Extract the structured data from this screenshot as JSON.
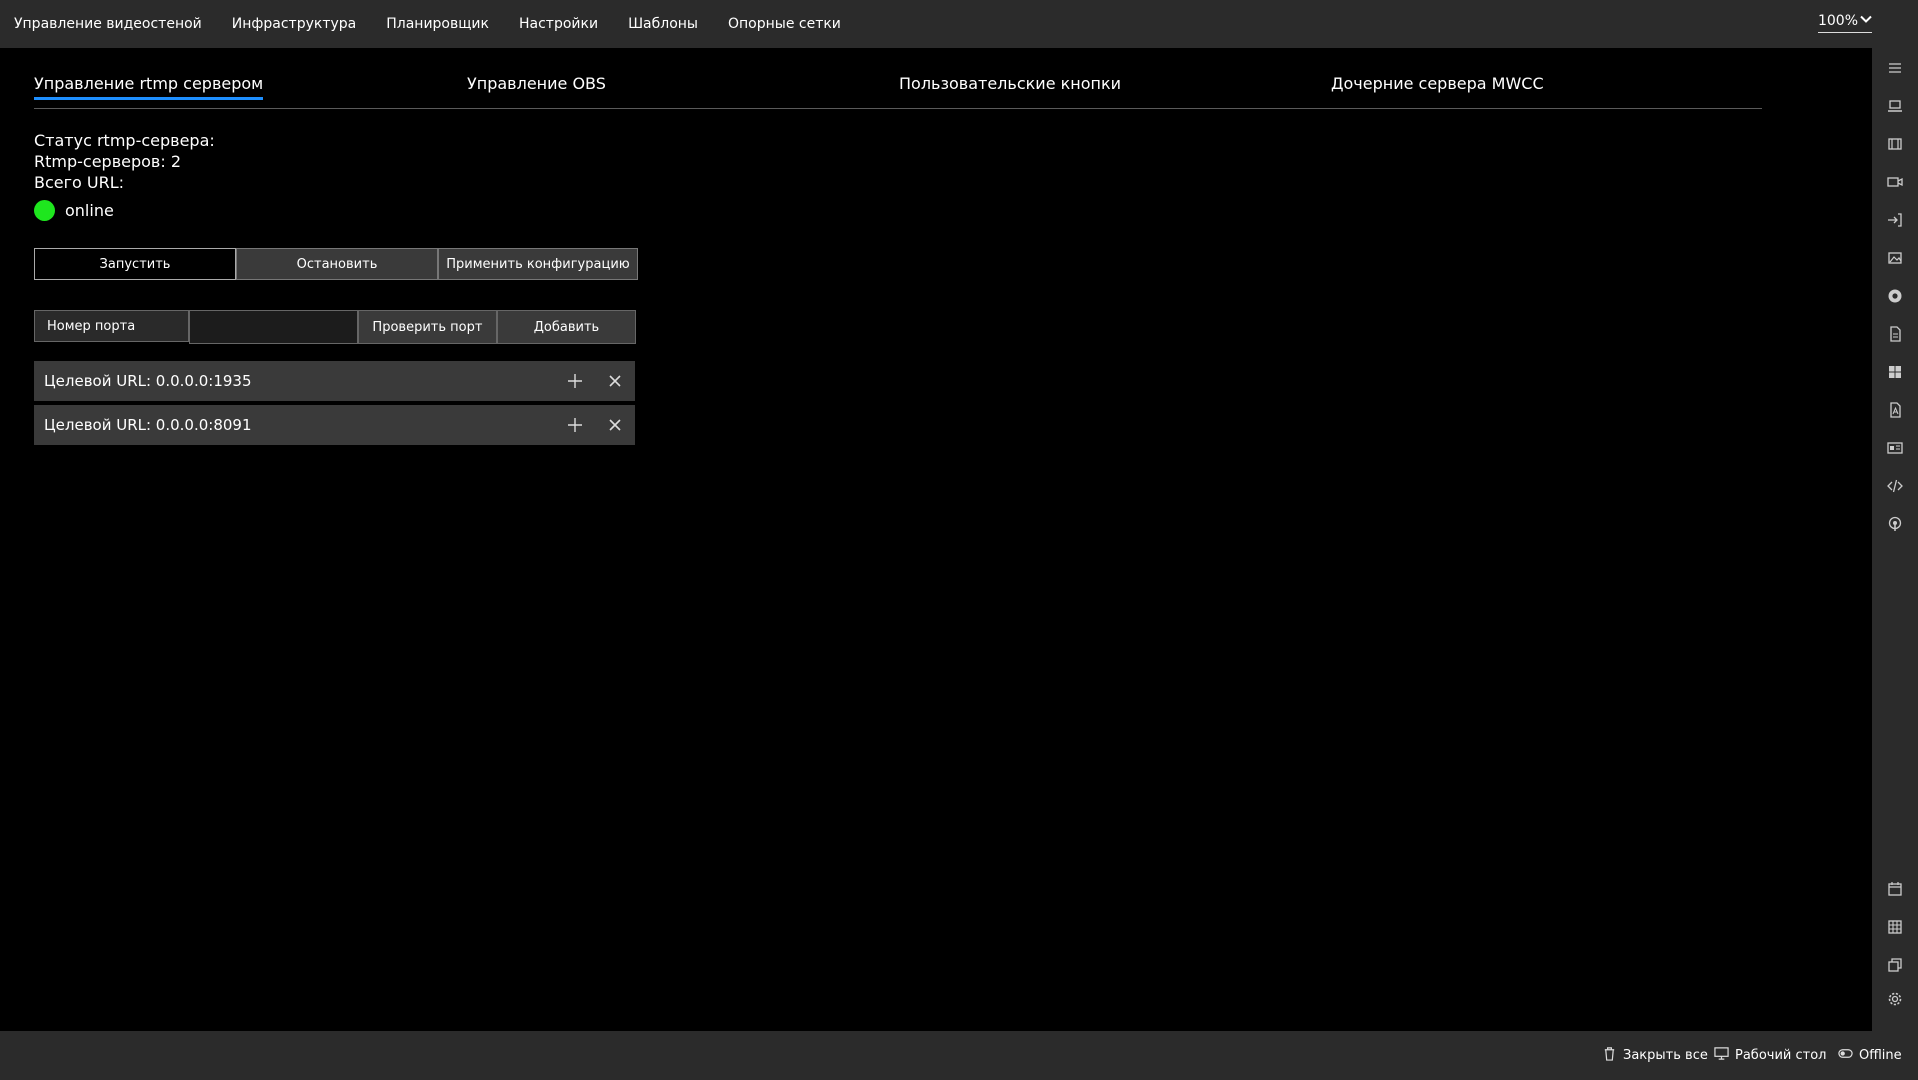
{
  "topbar": {
    "menu": [
      "Управление видеостеной",
      "Инфраструктура",
      "Планировщик",
      "Настройки",
      "Шаблоны",
      "Опорные сетки"
    ],
    "zoom": "100%"
  },
  "tabs": [
    {
      "label": "Управление rtmp сервером",
      "active": true
    },
    {
      "label": "Управление OBS",
      "active": false
    },
    {
      "label": "Пользовательские кнопки",
      "active": false
    },
    {
      "label": "Дочерние сервера MWCC",
      "active": false
    }
  ],
  "status": {
    "server_status": "Статус rtmp-сервера:",
    "servers_count": "Rtmp-серверов: 2",
    "total_url": "Всего URL:",
    "online_label": "online",
    "online_color": "#1ee61e"
  },
  "actions": {
    "start": "Запустить",
    "stop": "Остановить",
    "apply": "Применить конфигурацию"
  },
  "port": {
    "label": "Номер порта",
    "value": "",
    "check": "Проверить порт",
    "add": "Добавить"
  },
  "urls": [
    {
      "label": "Целевой URL: 0.0.0.0:1935"
    },
    {
      "label": "Целевой URL: 0.0.0.0:8091"
    }
  ],
  "sidebar_icons": [
    "menu-icon",
    "laptop-icon",
    "film-icon",
    "video-camera-icon",
    "sign-in-icon",
    "image-icon",
    "chrome-icon",
    "document-icon",
    "windows-icon",
    "pdf-icon",
    "id-card-icon",
    "code-icon",
    "podcast-icon",
    "calendar-icon",
    "grid-icon",
    "layers-icon",
    "gear-icon"
  ],
  "bottombar": {
    "close_all": "Закрыть все",
    "desktop": "Рабочий стол",
    "offline": "Offline"
  },
  "colors": {
    "accent": "#1e8fff",
    "bar_bg": "#2b2b2b",
    "background": "#000000"
  }
}
